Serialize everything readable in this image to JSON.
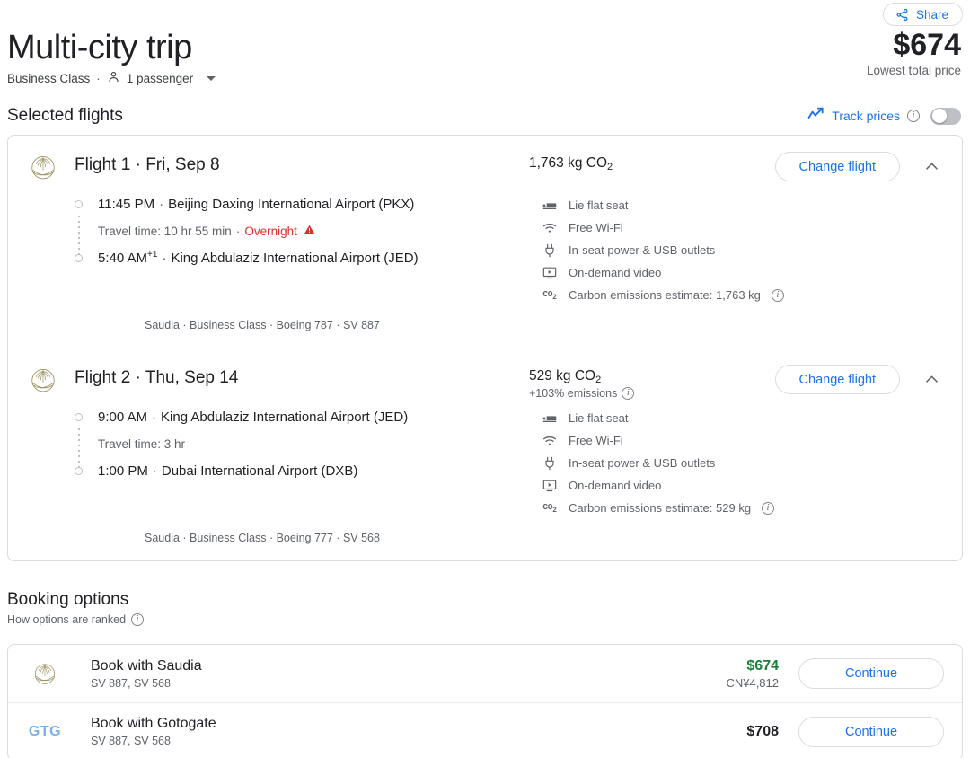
{
  "header": {
    "share_label": "Share",
    "share_icon": "share-icon",
    "title": "Multi-city trip",
    "cabin_class": "Business Class",
    "separator": "·",
    "passenger_icon": "person-icon",
    "passengers": "1 passenger",
    "total_price": "$674",
    "price_caption": "Lowest total price"
  },
  "selected_flights": {
    "section_title": "Selected flights",
    "track_prices_label": "Track prices",
    "track_prices_icon": "trending-up-icon",
    "track_prices_info_icon": "info-icon",
    "track_prices_enabled": false
  },
  "flights": [
    {
      "airline_logo": "saudia-logo",
      "headline": "Flight 1 · Fri, Sep 8",
      "co2_main": "1,763 kg CO",
      "co2_sub_numeral": "2",
      "co2_delta": "",
      "change_flight_label": "Change flight",
      "collapse_icon": "chevron-up-icon",
      "departure_time": "11:45 PM",
      "departure_time_sup": "",
      "departure_sep": "·",
      "departure_airport": "Beijing Daxing International Airport (PKX)",
      "travel_time": "Travel time: 10 hr 55 min",
      "travel_sep": "·",
      "overnight_label": "Overnight",
      "overnight_icon": "warning-triangle-icon",
      "arrival_time": "5:40 AM",
      "arrival_time_sup": "+1",
      "arrival_sep": "·",
      "arrival_airport": "King Abdulaziz International Airport (JED)",
      "meta": "Saudia · Business Class · Boeing 787 · SV 887",
      "amenities": [
        {
          "icon": "lie-flat-seat-icon",
          "label": "Lie flat seat"
        },
        {
          "icon": "wifi-icon",
          "label": "Free Wi-Fi"
        },
        {
          "icon": "power-plug-icon",
          "label": "In-seat power & USB outlets"
        },
        {
          "icon": "video-player-icon",
          "label": "On-demand video"
        },
        {
          "icon": "co2-icon",
          "label": "Carbon emissions estimate: 1,763 kg",
          "info_icon": "info-icon"
        }
      ]
    },
    {
      "airline_logo": "saudia-logo",
      "headline": "Flight 2 · Thu, Sep 14",
      "co2_main": "529 kg CO",
      "co2_sub_numeral": "2",
      "co2_delta": "+103% emissions",
      "co2_delta_info_icon": "info-icon",
      "change_flight_label": "Change flight",
      "collapse_icon": "chevron-up-icon",
      "departure_time": "9:00 AM",
      "departure_time_sup": "",
      "departure_sep": "·",
      "departure_airport": "King Abdulaziz International Airport (JED)",
      "travel_time": "Travel time: 3 hr",
      "travel_sep": "",
      "overnight_label": "",
      "arrival_time": "1:00 PM",
      "arrival_time_sup": "",
      "arrival_sep": "·",
      "arrival_airport": "Dubai International Airport (DXB)",
      "meta": "Saudia · Business Class · Boeing 777 · SV 568",
      "amenities": [
        {
          "icon": "lie-flat-seat-icon",
          "label": "Lie flat seat"
        },
        {
          "icon": "wifi-icon",
          "label": "Free Wi-Fi"
        },
        {
          "icon": "power-plug-icon",
          "label": "In-seat power & USB outlets"
        },
        {
          "icon": "video-player-icon",
          "label": "On-demand video"
        },
        {
          "icon": "co2-icon",
          "label": "Carbon emissions estimate: 529 kg",
          "info_icon": "info-icon"
        }
      ]
    }
  ],
  "booking_options": {
    "title": "Booking options",
    "ranked_label": "How options are ranked",
    "ranked_info_icon": "info-icon",
    "rows": [
      {
        "logo": "saudia-logo",
        "name": "Book with Saudia",
        "flight_numbers": "SV 887, SV 568",
        "price": "$674",
        "price_highlight": true,
        "price_alt": "CN¥4,812",
        "button_label": "Continue"
      },
      {
        "logo": "gotogate-logo",
        "logo_text": "GTG",
        "name": "Book with Gotogate",
        "flight_numbers": "SV 887, SV 568",
        "price": "$708",
        "price_highlight": false,
        "price_alt": "",
        "button_label": "Continue"
      }
    ]
  },
  "colors": {
    "accent_blue": "#1a73e8",
    "price_green": "#188038",
    "warning_red": "#d93025",
    "saudia_gold": "#9a8f5e",
    "gotogate_blue": "#79b0e8",
    "border": "#dadce0",
    "text_primary": "#202124",
    "text_secondary": "#5f6368"
  }
}
